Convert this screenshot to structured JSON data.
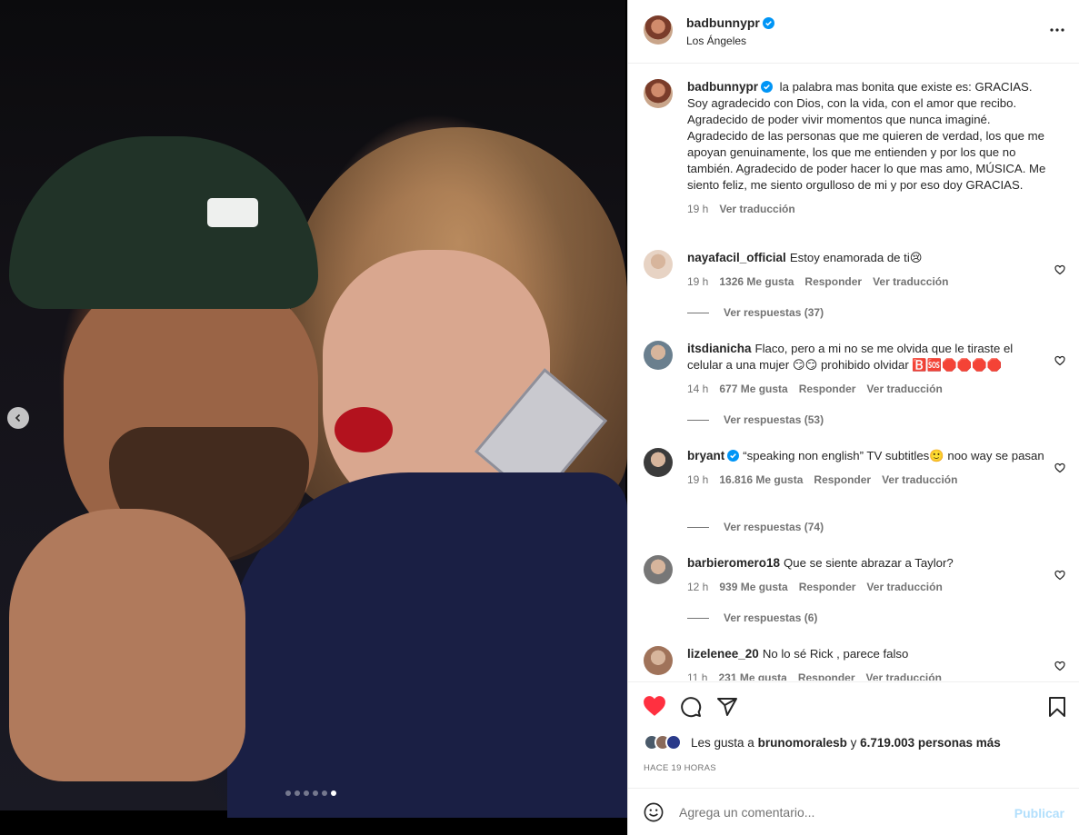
{
  "post": {
    "username": "badbunnypr",
    "location": "Los Ángeles",
    "caption": "la palabra mas bonita que existe es: GRACIAS. Soy agradecido con Dios, con la vida, con el amor que recibo. Agradecido de poder vivir momentos que nunca imaginé. Agradecido de las personas que me quieren de verdad, los que me apoyan genuinamente, los que me entienden y por los que no también. Agradecido de poder hacer lo que mas amo, MÚSICA. Me siento feliz, me siento orgulloso de mi y por eso doy GRACIAS.",
    "caption_time": "19 h",
    "see_translation": "Ver traducción",
    "carousel_total": 6,
    "carousel_active": 6
  },
  "comments": [
    {
      "username": "nayafacil_official",
      "verified": false,
      "text": "Estoy enamorada de ti😢",
      "time": "19 h",
      "likes": "1326 Me gusta",
      "reply": "Responder",
      "translate": "Ver traducción",
      "replies": "Ver respuestas (37)"
    },
    {
      "username": "itsdianicha",
      "verified": false,
      "text": "Flaco, pero a mi no se me olvida que le tiraste el celular a una mujer 😏😏 prohibido olvidar 🅱️🆘🛑🛑🛑🛑",
      "time": "14 h",
      "likes": "677 Me gusta",
      "reply": "Responder",
      "translate": "Ver traducción",
      "replies": "Ver respuestas (53)"
    },
    {
      "username": "bryant",
      "verified": true,
      "text": "“speaking non english” TV subtitles🙂 noo way se pasan",
      "time": "19 h",
      "likes": "16.816 Me gusta",
      "reply": "Responder",
      "translate": "Ver traducción",
      "replies": "Ver respuestas (74)"
    },
    {
      "username": "barbieromero18",
      "verified": false,
      "text": "Que se siente abrazar a Taylor?",
      "time": "12 h",
      "likes": "939 Me gusta",
      "reply": "Responder",
      "translate": "Ver traducción",
      "replies": "Ver respuestas (6)"
    },
    {
      "username": "lizelenee_20",
      "verified": false,
      "text": "No lo sé Rick , parece falso",
      "time": "11 h",
      "likes": "231 Me gusta",
      "reply": "Responder",
      "translate": "Ver traducción",
      "replies": ""
    }
  ],
  "likes": {
    "prefix": "Les gusta a",
    "user": "brunomoralesb",
    "connector": "y",
    "others": "6.719.003 personas más"
  },
  "post_time": "HACE 19 HORAS",
  "add_comment": {
    "placeholder": "Agrega un comentario...",
    "publish": "Publicar"
  },
  "icons": {
    "like": "heart-filled-icon",
    "comment": "comment-icon",
    "share": "share-icon",
    "save": "bookmark-icon",
    "more": "more-horizontal-icon",
    "emoji": "emoji-icon",
    "prev": "chevron-left-icon",
    "comment_like": "heart-outline-icon"
  },
  "colors": {
    "like_red": "#ff3040",
    "verified_blue": "#0095f6",
    "publish_disabled": "#b2dffc",
    "secondary_text": "#737373"
  }
}
